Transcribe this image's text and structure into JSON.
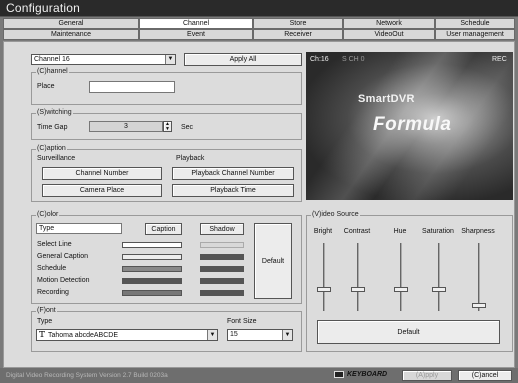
{
  "window": {
    "title": "Configuration"
  },
  "tabs_row1": [
    "General",
    "Channel",
    "Store",
    "Network",
    "Schedule"
  ],
  "tabs_row2": [
    "Maintenance",
    "Event",
    "Receiver",
    "VideoOut",
    "User management"
  ],
  "active_tab": "Channel",
  "channel_select": {
    "value": "Channel 16"
  },
  "apply_all_label": "Apply All",
  "channel_group": {
    "title": "(C)hannel",
    "place_label": "Place",
    "place_value": ""
  },
  "switching_group": {
    "title": "(S)witching",
    "time_gap_label": "Time Gap",
    "time_gap_value": "3",
    "unit": "Sec"
  },
  "caption_group": {
    "title": "(C)aption",
    "surveillance_label": "Surveillance",
    "playback_label": "Playback",
    "channel_number_btn": "Channel Number",
    "playback_channel_number_btn": "Playback Channel Number",
    "camera_place_btn": "Camera Place",
    "playback_time_btn": "Playback Time"
  },
  "color_group": {
    "title": "(C)olor",
    "type_header": "Type",
    "caption_btn": "Caption",
    "shadow_btn": "Shadow",
    "default_btn": "Default",
    "rows": [
      {
        "label": "Select Line",
        "caption": "#ffffff",
        "shadow": "#d8d8d8"
      },
      {
        "label": "General Caption",
        "caption": "#ececec",
        "shadow": "#555555"
      },
      {
        "label": "Schedule",
        "caption": "#888888",
        "shadow": "#555555"
      },
      {
        "label": "Motion Detection",
        "caption": "#555555",
        "shadow": "#555555"
      },
      {
        "label": "Recording",
        "caption": "#777777",
        "shadow": "#555555"
      }
    ]
  },
  "font_group": {
    "title": "(F)ont",
    "type_label": "Type",
    "font_size_label": "Font Size",
    "font_value": "Tahoma  abcdeABCDE",
    "font_icon": "truetype-icon",
    "font_size_value": "15"
  },
  "video_preview": {
    "channel_label": "Ch:16",
    "overlay_text": "S  CH 0",
    "rec_label": "REC",
    "brand_line1": "SmartDVR",
    "brand_line2": "Formula"
  },
  "video_source_group": {
    "title": "(V)ideo Source",
    "sliders": [
      {
        "label": "Bright",
        "value": 0.3
      },
      {
        "label": "Contrast",
        "value": 0.3
      },
      {
        "label": "Hue",
        "value": 0.3
      },
      {
        "label": "Saturation",
        "value": 0.3
      },
      {
        "label": "Sharpness",
        "value": 0.05
      }
    ],
    "default_btn": "Default"
  },
  "status_bar": {
    "version_text": "Digital Video Recording System Version 2.7 Build 0203a",
    "keyboard_label": "KEYBOARD",
    "apply_label": "(A)pply",
    "cancel_label": "(C)ancel"
  }
}
